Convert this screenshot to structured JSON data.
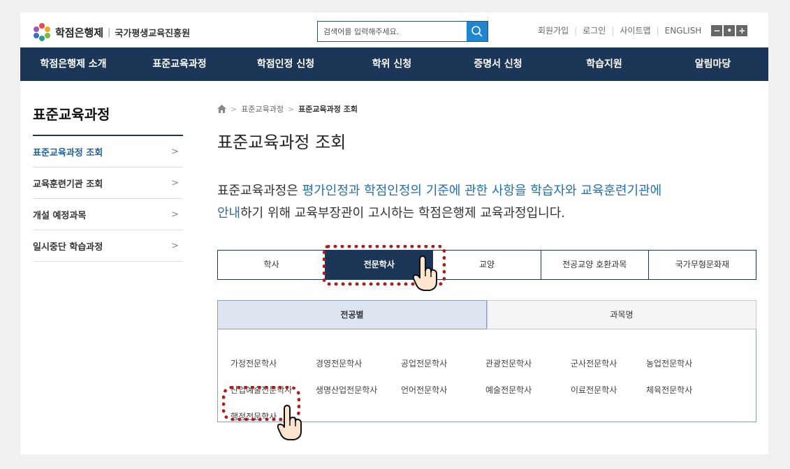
{
  "header": {
    "logo_title": "학점은행제",
    "logo_sep": "|",
    "logo_org": "국가평생교육진흥원",
    "search_placeholder": "검색어를 입력해주세요.",
    "util_links": [
      "회원가입",
      "로그인",
      "사이트맵",
      "ENGLISH"
    ],
    "zoom": [
      "−",
      "•",
      "+"
    ]
  },
  "gnb": [
    "학점은행제 소개",
    "표준교육과정",
    "학점인정 신청",
    "학위 신청",
    "증명서 신청",
    "학습지원",
    "알림마당"
  ],
  "lnb": {
    "title": "표준교육과정",
    "items": [
      {
        "label": "표준교육과정 조회",
        "active": true
      },
      {
        "label": "교육훈련기관 조회",
        "active": false
      },
      {
        "label": "개설 예정과목",
        "active": false
      },
      {
        "label": "일시중단 학습과정",
        "active": false
      }
    ],
    "chevron": ">"
  },
  "breadcrumb": {
    "sep": ">",
    "level1": "표준교육과정",
    "current": "표준교육과정 조회"
  },
  "page_title": "표준교육과정 조회",
  "description": {
    "p1": "표준교육과정은 ",
    "h1": "평가인정과 학점인정의 기준에 관한 사항을 학습자와 교육훈련기관에",
    "h2": "안내",
    "p2": "하기 위해 교육부장관이 고시하는 학점은행제 교육과정입니다."
  },
  "degree_tabs": [
    "학사",
    "전문학사",
    "교양",
    "전공교양 호환과목",
    "국가무형문화재"
  ],
  "degree_tab_active": 1,
  "search_tabs": [
    "전공별",
    "과목명"
  ],
  "search_tab_active": 0,
  "majors": [
    "가정전문학사",
    "경영전문학사",
    "공업전문학사",
    "관광전문학사",
    "군사전문학사",
    "농업전문학사",
    "산업예술전문학사",
    "생명산업전문학사",
    "언어전문학사",
    "예술전문학사",
    "이료전문학사",
    "체육전문학사",
    "행정전문학사"
  ],
  "colors": {
    "navy": "#1c3658",
    "accent": "#1f6fb8",
    "highlight": "#b31b1b"
  }
}
